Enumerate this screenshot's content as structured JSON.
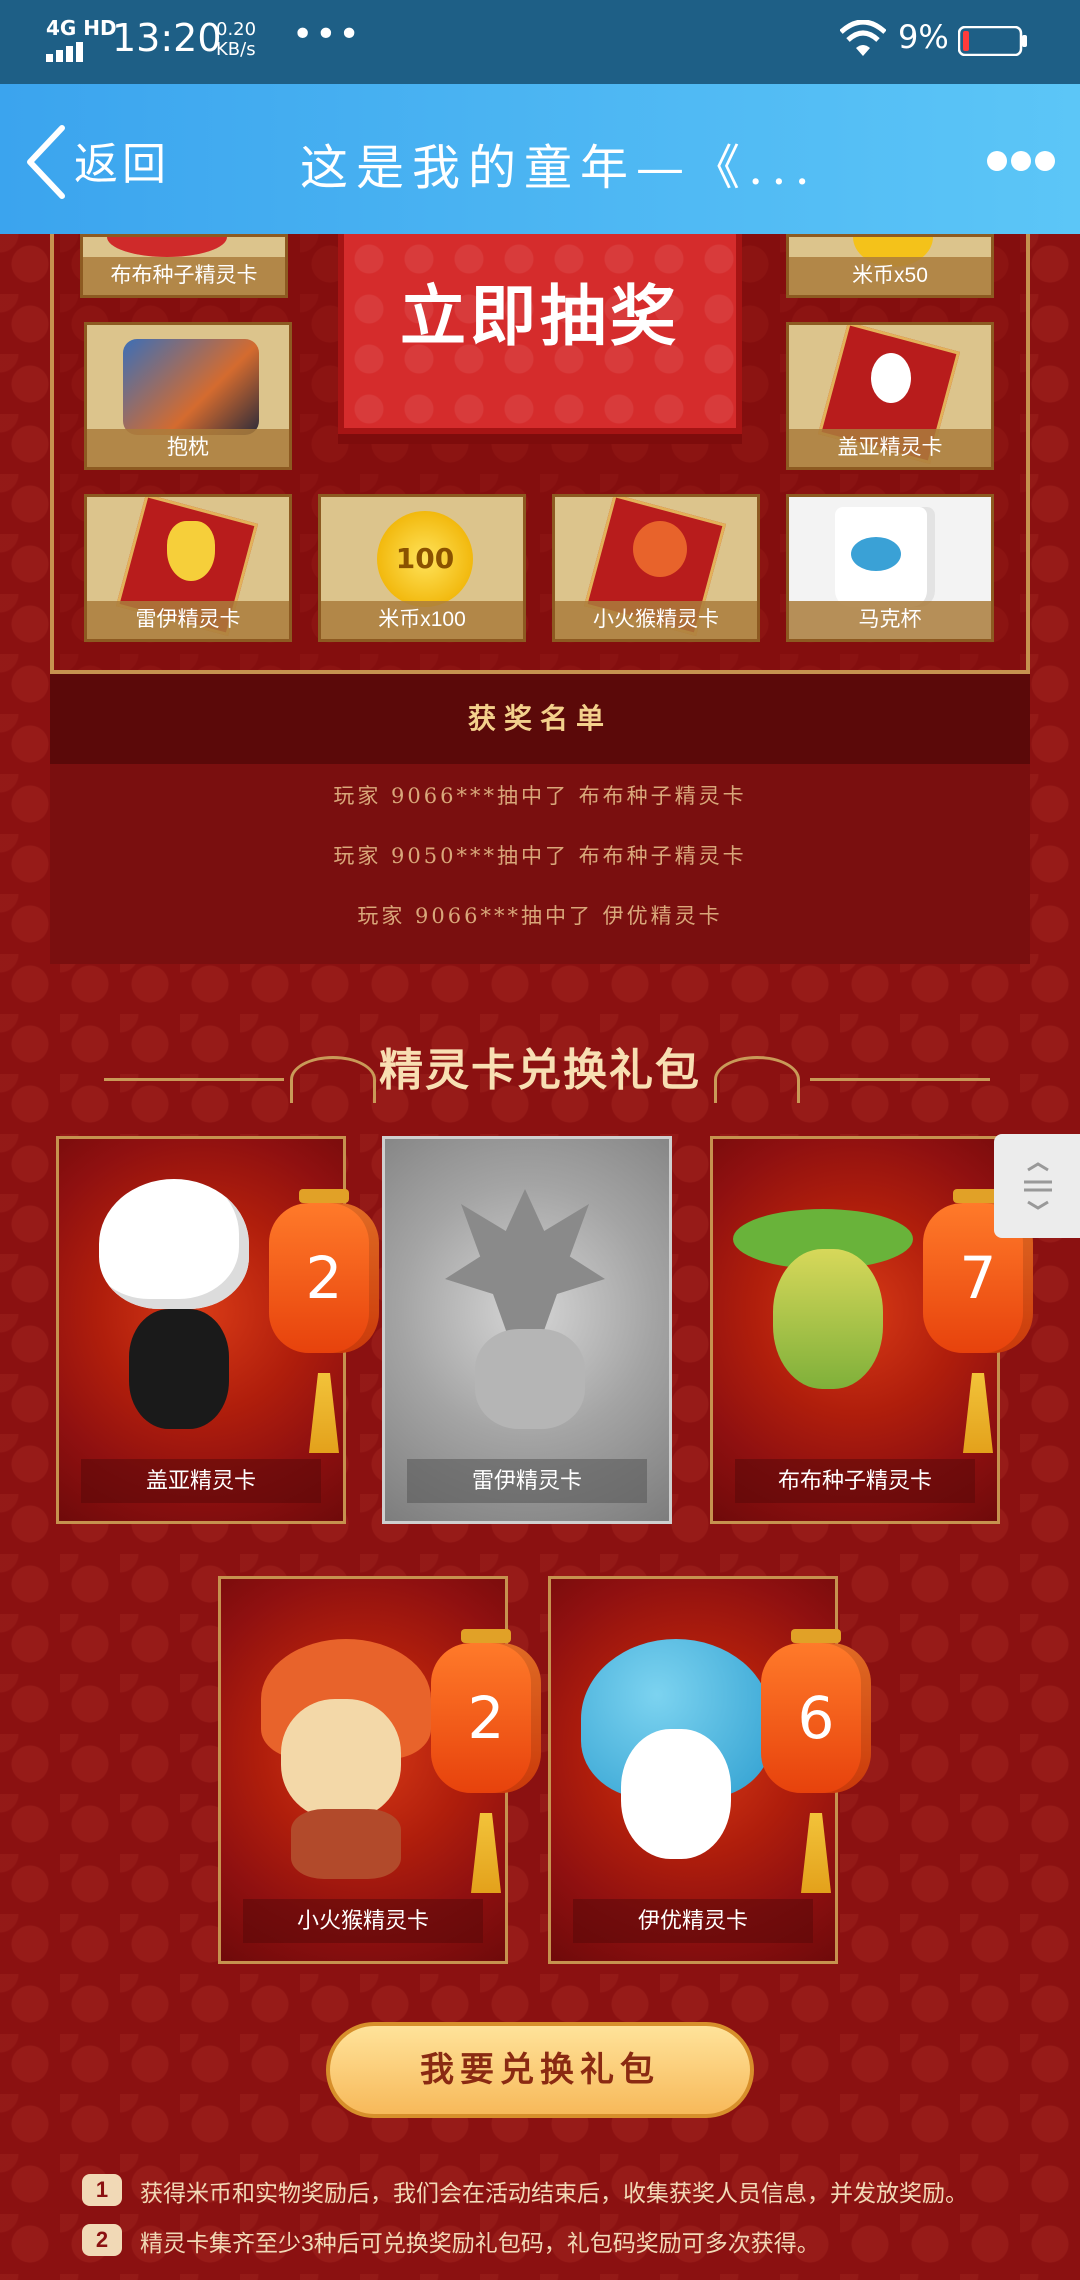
{
  "status_bar": {
    "network": "4G HD",
    "time": "13:20",
    "speed_value": "0.20",
    "speed_unit": "KB/s",
    "overflow": "•••",
    "battery_percent": "9%"
  },
  "header": {
    "back_label": "返回",
    "title": "这是我的童年—《..."
  },
  "prize_grid": {
    "prizes": [
      {
        "label": "布布种子精灵卡"
      },
      {
        "label": "米币x50"
      },
      {
        "label": "抱枕"
      },
      {
        "label": "盖亚精灵卡"
      },
      {
        "label": "雷伊精灵卡"
      },
      {
        "label": "米币x100"
      },
      {
        "label": "小火猴精灵卡"
      },
      {
        "label": "马克杯"
      }
    ],
    "coin_text": "100",
    "draw_button": "立即抽奖"
  },
  "winners": {
    "heading": "获奖名单",
    "entries": [
      "玩家 9066***抽中了 布布种子精灵卡",
      "玩家 9050***抽中了 布布种子精灵卡",
      "玩家 9066***抽中了 伊优精灵卡"
    ]
  },
  "exchange": {
    "title": "精灵卡兑换礼包",
    "cards": [
      {
        "name": "盖亚精灵卡",
        "count": "2",
        "owned": true
      },
      {
        "name": "雷伊精灵卡",
        "count": "",
        "owned": false
      },
      {
        "name": "布布种子精灵卡",
        "count": "7",
        "owned": true
      },
      {
        "name": "小火猴精灵卡",
        "count": "2",
        "owned": true
      },
      {
        "name": "伊优精灵卡",
        "count": "6",
        "owned": true
      }
    ],
    "button": "我要兑换礼包"
  },
  "rules": [
    {
      "num": "1",
      "text": "获得米币和实物奖励后，我们会在活动结束后，收集获奖人员信息，并发放奖励。"
    },
    {
      "num": "2",
      "text": "精灵卡集齐至少3种后可兑换奖励礼包码，礼包码奖励可多次获得。"
    }
  ],
  "colors": {
    "background": "#8b1111",
    "header_gradient": [
      "#3ba4ee",
      "#5cc6f7"
    ],
    "status_bar": "#1e5f86",
    "gold": "#c6924f",
    "button_gold": "#f7b95a"
  }
}
